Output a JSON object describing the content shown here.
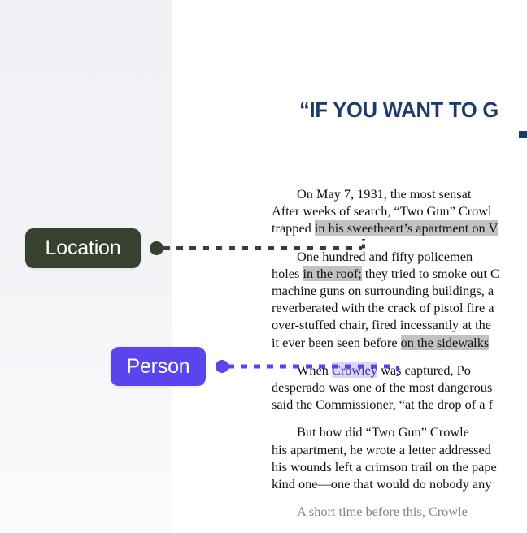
{
  "document": {
    "title": "“IF YOU WANT TO G",
    "title_color": "#1d3c6e",
    "paragraphs": [
      {
        "id": "p1",
        "segments": [
          {
            "text": "On May 7, 1931, the most sensat",
            "style": "plain",
            "indent": true
          },
          {
            "text": "After weeks of search, “Two Gun” Crowl",
            "style": "plain",
            "newline": true
          },
          {
            "text": "trapped ",
            "style": "plain",
            "newline": true
          },
          {
            "text": "in his sweetheart’s apartment on ",
            "style": "highlight-gray"
          },
          {
            "text": "V",
            "style": "plain"
          }
        ]
      },
      {
        "id": "p2",
        "segments": [
          {
            "text": "One hundred and fifty policemen",
            "style": "plain",
            "indent": true
          },
          {
            "text": "holes ",
            "style": "plain",
            "newline": true
          },
          {
            "text": "in the roof;",
            "style": "highlight-gray"
          },
          {
            "text": " they tried to smoke out ",
            "style": "plain"
          },
          {
            "text": "C",
            "style": "plain"
          },
          {
            "text": "machine guns on surrounding buildings, a",
            "style": "plain",
            "newline": true
          },
          {
            "text": "reverberated with the crack of pistol fire a",
            "style": "plain",
            "newline": true
          },
          {
            "text": "over-stuffed chair, fired incessantly at the",
            "style": "plain",
            "newline": true
          },
          {
            "text": "it ever been seen before ",
            "style": "plain",
            "newline": true
          },
          {
            "text": "on the sidewalks",
            "style": "highlight-gray"
          }
        ]
      },
      {
        "id": "p3",
        "segments": [
          {
            "text": "When ",
            "style": "plain",
            "indent": true
          },
          {
            "text": "Crowley",
            "style": "highlight-purple"
          },
          {
            "text": " was captured, Po",
            "style": "plain"
          },
          {
            "text": "desperado was one of the most dangerous",
            "style": "plain",
            "newline": true
          },
          {
            "text": "said the Commissioner, “at the drop of a f",
            "style": "plain",
            "newline": true
          }
        ]
      },
      {
        "id": "p4",
        "segments": [
          {
            "text": "But how did “Two Gun” Crowle",
            "style": "plain",
            "indent": true
          },
          {
            "text": "his apartment, he wrote a letter addressed",
            "style": "plain",
            "newline": true
          },
          {
            "text": "his wounds left a crimson trail on the pape",
            "style": "plain",
            "newline": true
          },
          {
            "text": "kind one—one that would do nobody any",
            "style": "plain",
            "newline": true
          }
        ]
      },
      {
        "id": "p5",
        "segments": [
          {
            "text": "A short time before this, Crowle",
            "style": "faint",
            "indent": true
          }
        ]
      }
    ]
  },
  "annotations": [
    {
      "id": "location",
      "label": "Location",
      "color": "#36412f",
      "target_text": "in his sweetheart’s apartment on V",
      "connector_style": "dashed"
    },
    {
      "id": "person",
      "label": "Person",
      "color": "#5b44ee",
      "target_text": "Crowley",
      "connector_style": "dashed"
    }
  ],
  "highlight_colors": {
    "gray": "#c2c2c2",
    "purple": "#dcd6f6",
    "purple_text": "#3c2f9e"
  },
  "panel": {
    "background_top": "#f0f0f5",
    "background_bottom": "#fbfbfc"
  }
}
